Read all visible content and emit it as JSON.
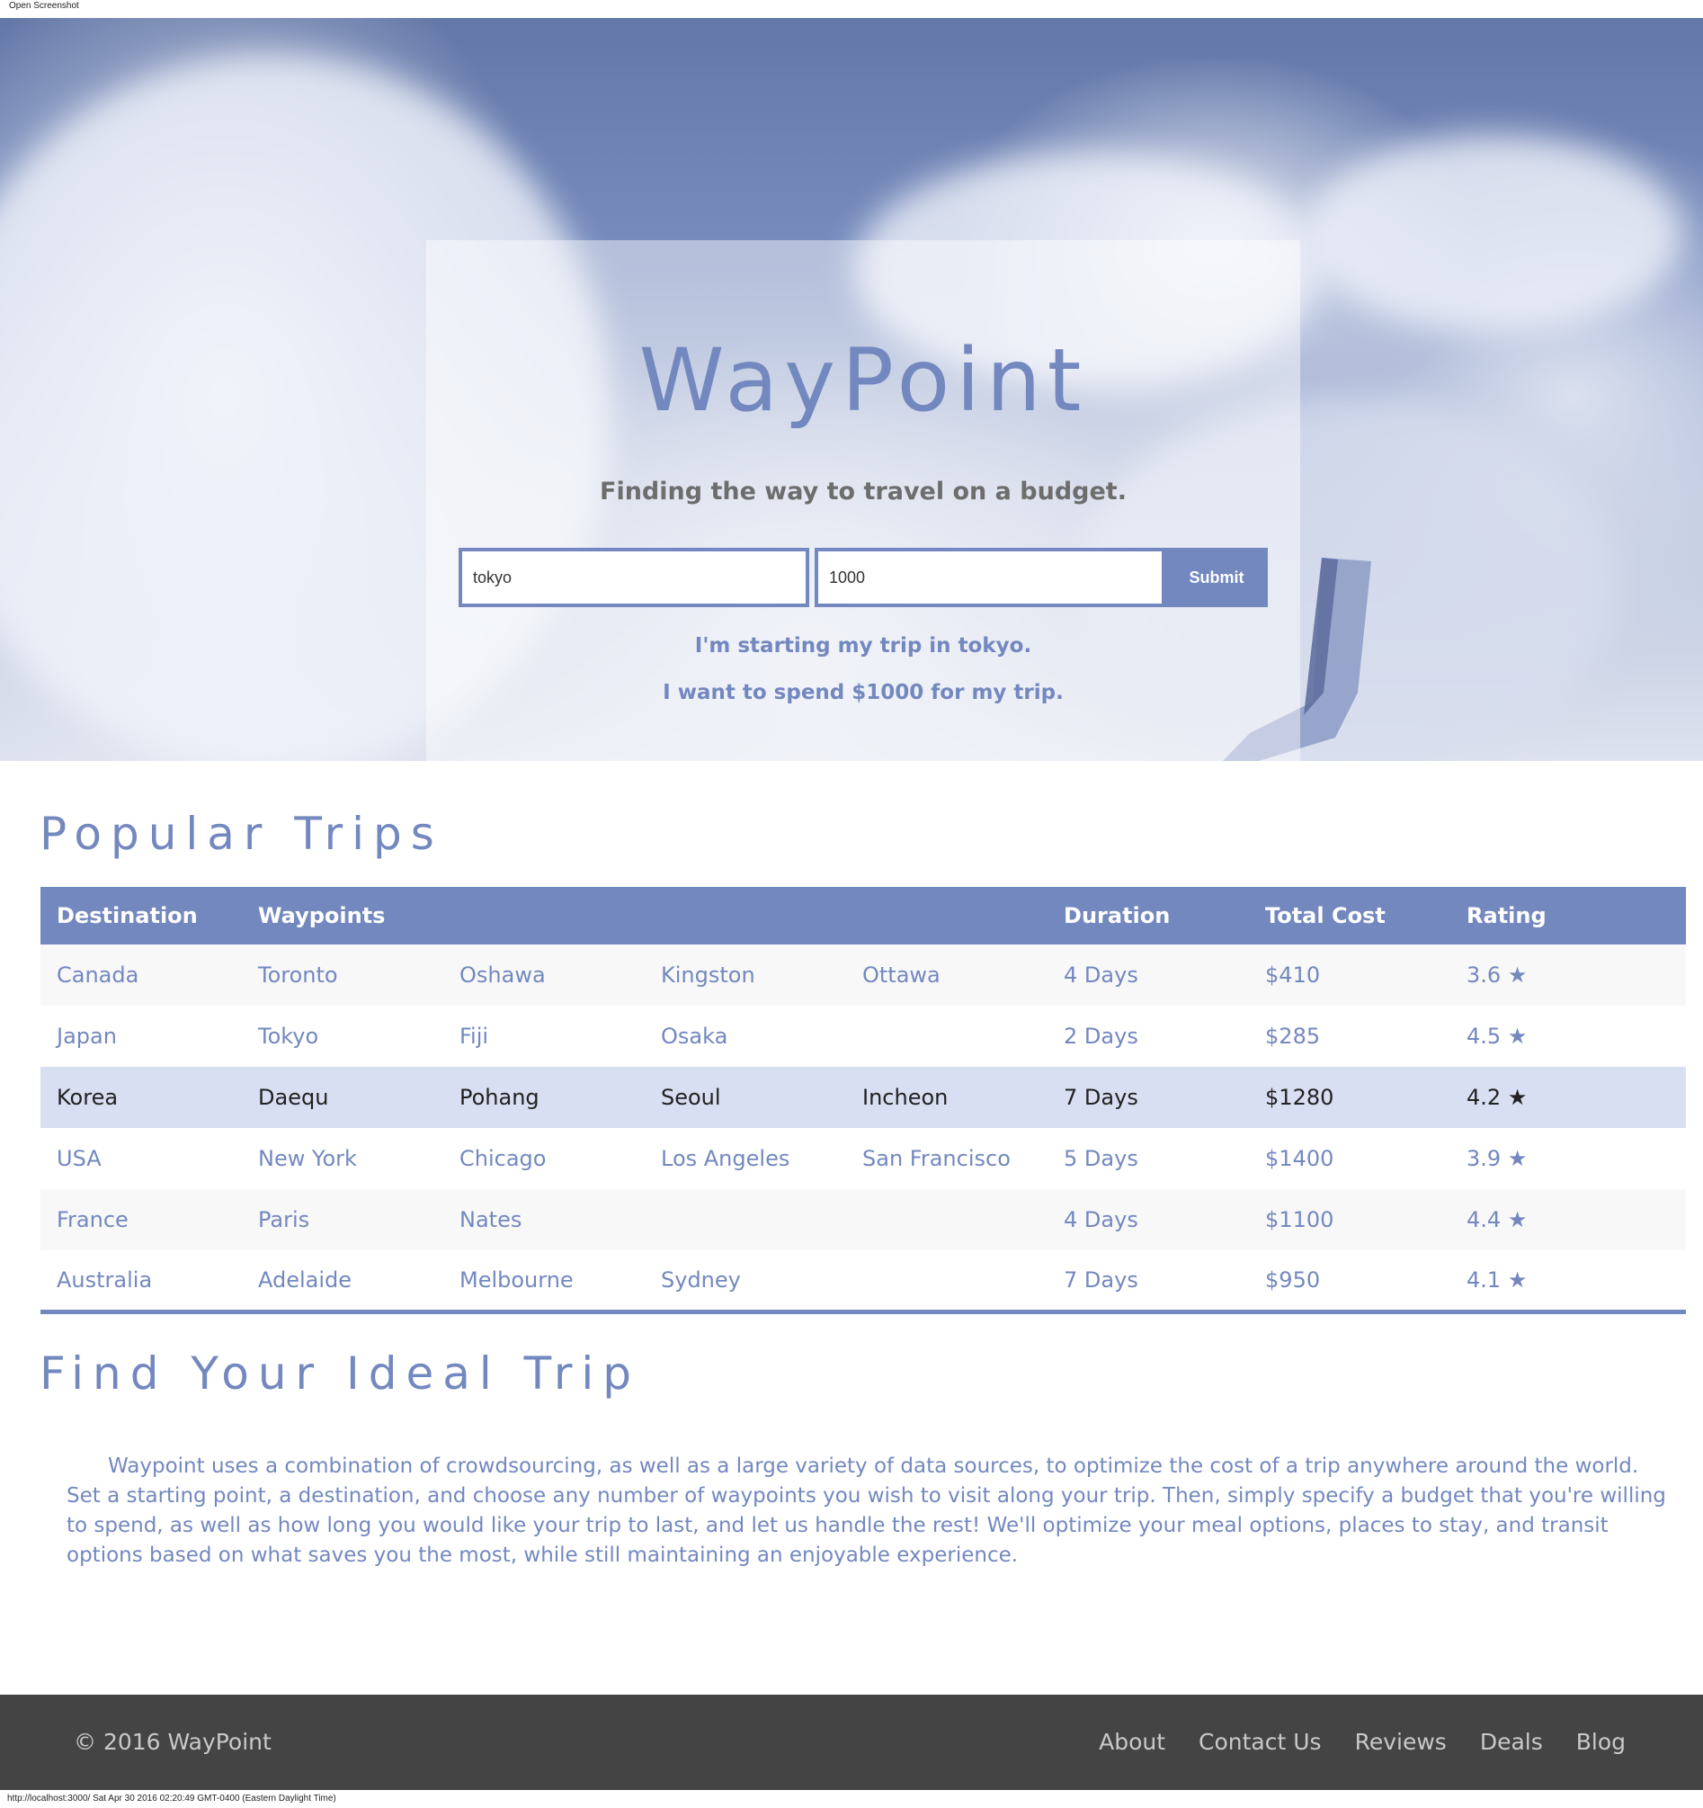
{
  "browser": {
    "top_label": "Open Screenshot",
    "status": "http://localhost:3000/ Sat Apr 30 2016 02:20:49 GMT-0400 (Eastern Daylight Time)"
  },
  "hero": {
    "brand": "WayPoint",
    "tagline": "Finding the way to travel on a budget.",
    "from_value": "tokyo",
    "budget_value": "1000",
    "submit_label": "Submit",
    "echo_start": "I'm starting my trip in tokyo.",
    "echo_budget": "I want to spend $1000 for my trip."
  },
  "popular": {
    "title": "Popular Trips",
    "columns": [
      "Destination",
      "Waypoints",
      "Duration",
      "Total Cost",
      "Rating"
    ],
    "rows": [
      {
        "destination": "Canada",
        "waypoints": [
          "Toronto",
          "Oshawa",
          "Kingston",
          "Ottawa"
        ],
        "duration": "4 Days",
        "cost": "$410",
        "rating": "3.6 ★"
      },
      {
        "destination": "Japan",
        "waypoints": [
          "Tokyo",
          "Fiji",
          "Osaka",
          ""
        ],
        "duration": "2 Days",
        "cost": "$285",
        "rating": "4.5 ★"
      },
      {
        "destination": "Korea",
        "waypoints": [
          "Daequ",
          "Pohang",
          "Seoul",
          "Incheon"
        ],
        "duration": "7 Days",
        "cost": "$1280",
        "rating": "4.2 ★"
      },
      {
        "destination": "USA",
        "waypoints": [
          "New York",
          "Chicago",
          "Los Angeles",
          "San Francisco"
        ],
        "duration": "5 Days",
        "cost": "$1400",
        "rating": "3.9 ★"
      },
      {
        "destination": "France",
        "waypoints": [
          "Paris",
          "Nates",
          "",
          ""
        ],
        "duration": "4 Days",
        "cost": "$1100",
        "rating": "4.4 ★"
      },
      {
        "destination": "Australia",
        "waypoints": [
          "Adelaide",
          "Melbourne",
          "Sydney",
          ""
        ],
        "duration": "7 Days",
        "cost": "$950",
        "rating": "4.1 ★"
      }
    ]
  },
  "ideal": {
    "title": "Find Your Ideal Trip",
    "body": "Waypoint uses a combination of crowdsourcing, as well as a large variety of data sources, to optimize the cost of a trip anywhere around the world. Set a starting point, a destination, and choose any number of waypoints you wish to visit along your trip. Then, simply specify a budget that you're willing to spend, as well as how long you would like your trip to last, and let us handle the rest! We'll optimize your meal options, places to stay, and transit options based on what saves you the most, while still maintaining an enjoyable experience."
  },
  "footer": {
    "copyright": "© 2016 WayPoint",
    "links": [
      "About",
      "Contact Us",
      "Reviews",
      "Deals",
      "Blog"
    ]
  },
  "colors": {
    "accent": "#7388bf",
    "highlight_row": "#d8dff2",
    "footer_bg": "#444444"
  }
}
